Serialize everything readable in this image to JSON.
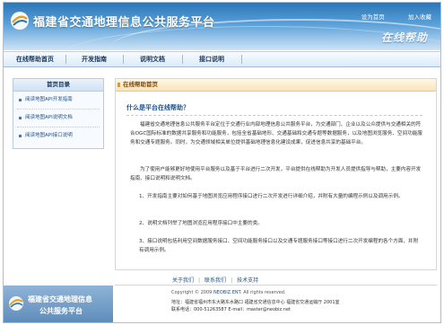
{
  "header": {
    "site_title": "福建省交通地理信息公共服务平台",
    "links": [
      "设为首页",
      "加入收藏"
    ],
    "slogan": "在线帮助"
  },
  "nav": {
    "items": [
      "在线帮助首页",
      "开发指南",
      "说明文档",
      "接口说明"
    ]
  },
  "sidebar": {
    "title": "首页目录",
    "items": [
      "阅读地图API开发指南",
      "阅读地图API说明文档",
      "阅读地图API接口说明"
    ]
  },
  "content": {
    "title": "在线帮助首页",
    "question": "什么是平台在线帮助？",
    "para1": "福建省交通地理信息公共服务平台定位于交通行业内部地理信息公共服务平台，为交通部门、企业以及公众提供与交通相关的符合OGC国际标准的数据共享服务和功能服务，包括全省基础地形、交通基础和交通专题等数据服务，以及地图浏览服务、空间功能服务和交通专题服务。同时，为交通领域相关单位提供基础地理信息化建设成果，促进信息共享的基础平台。",
    "para2": "为了使用户能够更好地使用平台服务以及基于平台进行二次开发，平台提供在线帮助为开发人员提供指导与帮助，主要内容开发指南、接口说明和说明文档。",
    "list": [
      "1、开发指南主要对如何基于地图浏览应用程序接口进行二次开发进行详细介绍，并附有大量的编程示例以及调用示例。",
      "2、说明文档列举了地图浏览应用程序接口中主要的类。",
      "3、接口说明包括利用空间数据服务接口、空间功能服务接口以及交通专题服务接口等接口进行二次开发编程的各个方面，并附有调用示例。"
    ]
  },
  "footer": {
    "links": [
      "关于我们",
      "联系我们",
      "技术支持"
    ],
    "logo_line1": "福建省交通地理信息",
    "logo_line2": "公共服务平台",
    "copyright_prefix": "Copyright © 2009 ",
    "copyright_link": "NEOBIZ.ENT.",
    "copyright_suffix": " All rights reserved.",
    "address": "地址：福建省福州市东大路东水路口    福建省交通信息中心 福建省交通运输厅 2001室",
    "phone_email": "联系电话：000-51263587   E-mail：master@neobiz.net"
  },
  "colors": {
    "banner_top": "#2c76b8",
    "nav_text": "#17365d",
    "content_head_bg": "#fbe3b8",
    "question_text": "#1d4f8a"
  }
}
